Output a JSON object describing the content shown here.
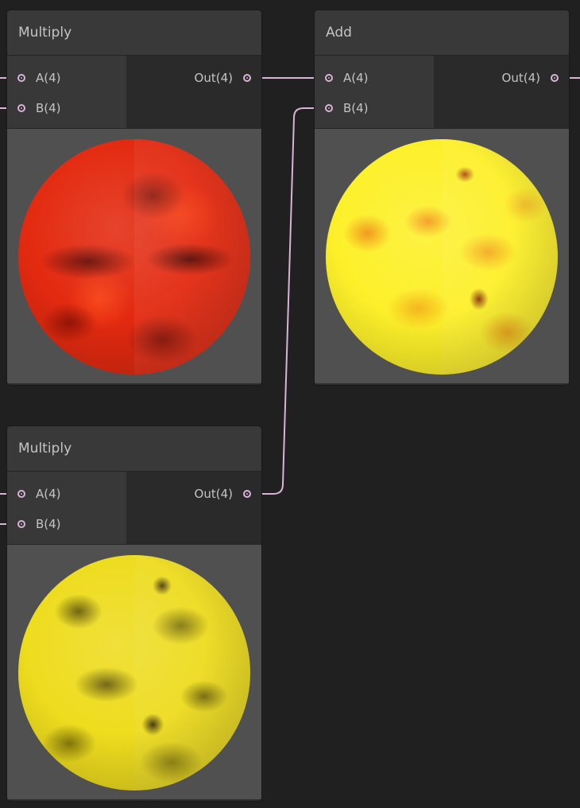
{
  "wire_color": "#d8b4d6",
  "nodes": {
    "multiply_top": {
      "title": "Multiply",
      "inputs": [
        "A(4)",
        "B(4)"
      ],
      "output": "Out(4)",
      "preview": "red-noise-sphere"
    },
    "add": {
      "title": "Add",
      "inputs": [
        "A(4)",
        "B(4)"
      ],
      "output": "Out(4)",
      "preview": "orange-yellow-noise-sphere"
    },
    "multiply_bottom": {
      "title": "Multiply",
      "inputs": [
        "A(4)",
        "B(4)"
      ],
      "output": "Out(4)",
      "preview": "yellow-noise-sphere"
    }
  }
}
